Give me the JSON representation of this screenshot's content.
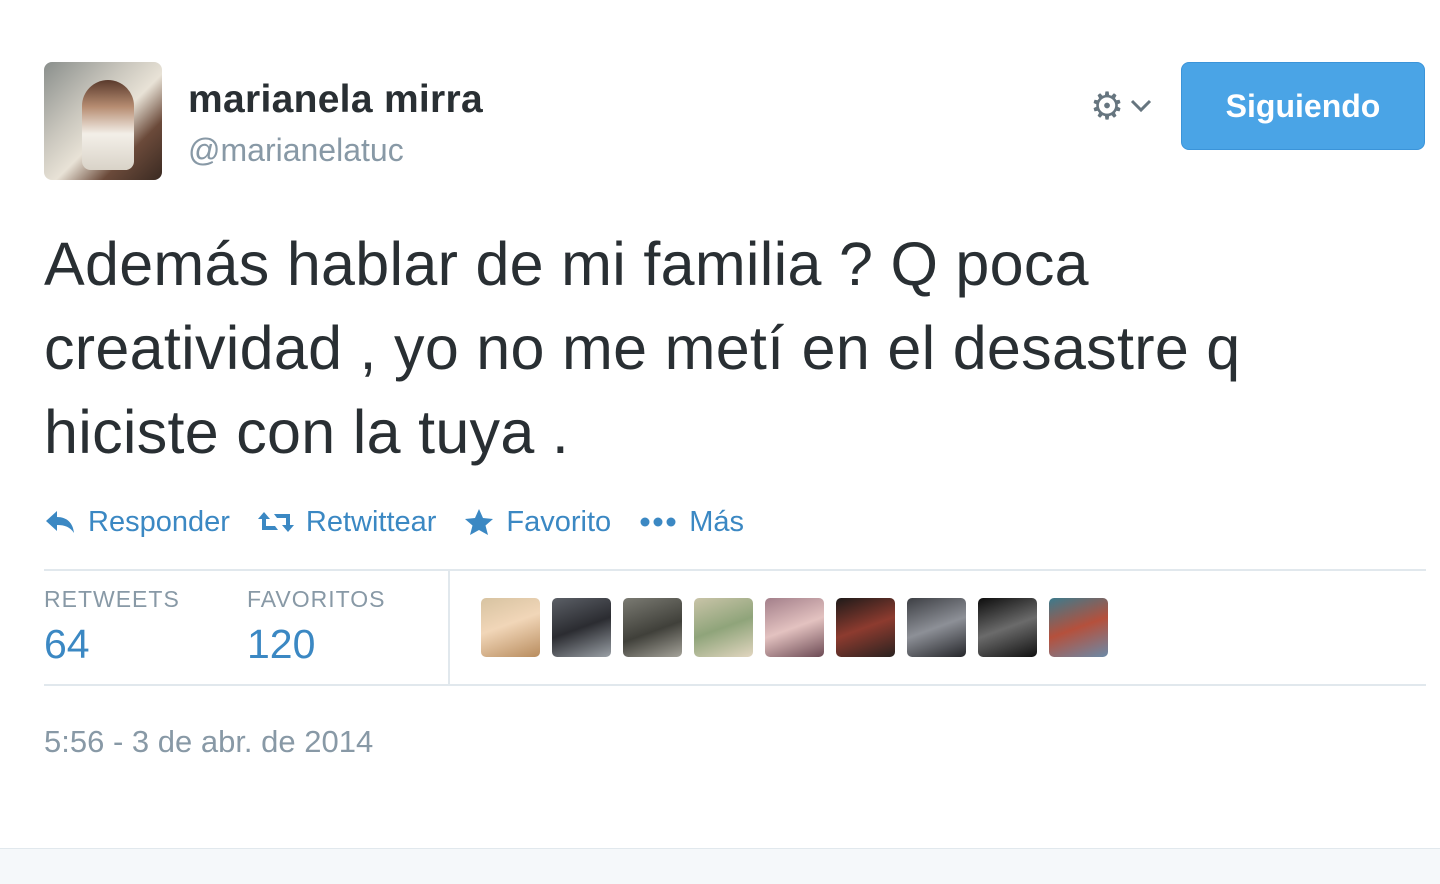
{
  "user": {
    "name": "marianela mirra",
    "handle": "@marianelatuc",
    "follow_label": "Siguiendo",
    "settings_icon": "gear-icon"
  },
  "tweet": {
    "text": "Además hablar de mi familia ? Q poca creatividad , yo no me metí en el desastre q hiciste con la tuya .",
    "timestamp": "5:56 - 3 de abr. de 2014"
  },
  "actions": [
    {
      "label": "Responder",
      "icon": "reply-icon"
    },
    {
      "label": "Retwittear",
      "icon": "retweet-icon"
    },
    {
      "label": "Favorito",
      "icon": "star-icon"
    },
    {
      "label": "Más",
      "icon": "more-icon"
    }
  ],
  "stats": {
    "retweets_label": "RETWEETS",
    "retweets_value": "64",
    "favorites_label": "FAVORITOS",
    "favorites_value": "120"
  },
  "colors": {
    "accent": "#3b88c3",
    "button": "#4aa4e6",
    "muted": "#8899a6",
    "text": "#292f33"
  }
}
